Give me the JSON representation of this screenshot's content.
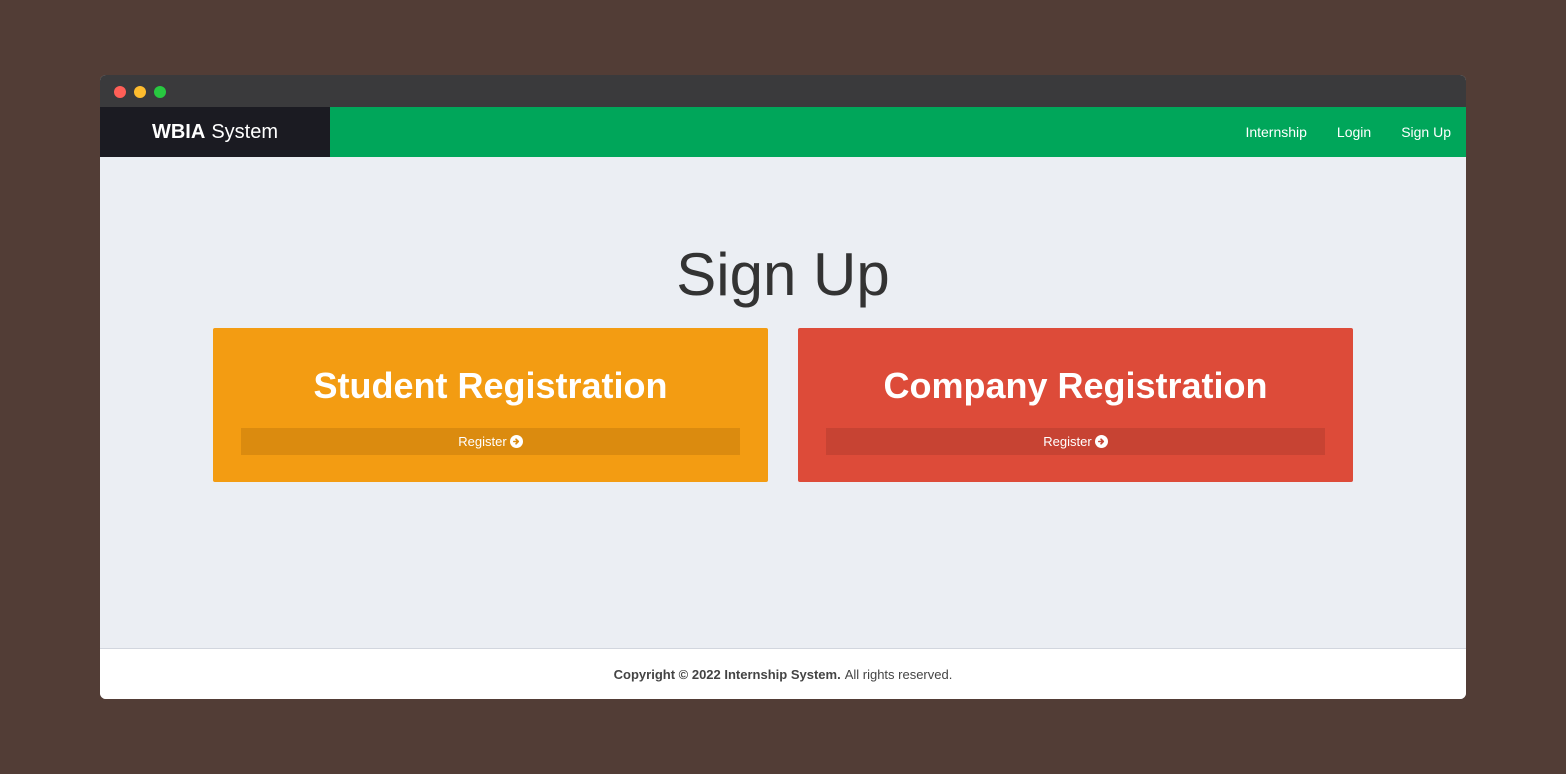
{
  "window": {
    "controls": [
      "close",
      "minimize",
      "maximize"
    ]
  },
  "navbar": {
    "brand_bold": "WBIA",
    "brand_light": "System",
    "links": [
      {
        "label": "Internship"
      },
      {
        "label": "Login"
      },
      {
        "label": "Sign Up"
      }
    ]
  },
  "main": {
    "title": "Sign Up",
    "cards": [
      {
        "title": "Student Registration",
        "button_label": "Register",
        "icon": "arrow-circle-right-icon",
        "color": "#f39c12"
      },
      {
        "title": "Company Registration",
        "button_label": "Register",
        "icon": "arrow-circle-right-icon",
        "color": "#dd4b39"
      }
    ]
  },
  "footer": {
    "copyright": "Copyright © 2022 Internship System.",
    "rights": "All rights reserved."
  },
  "colors": {
    "navbar": "#00a65a",
    "brand_bg": "#1b1b22",
    "page_bg": "#ebeef3",
    "backdrop": "#523d36"
  }
}
